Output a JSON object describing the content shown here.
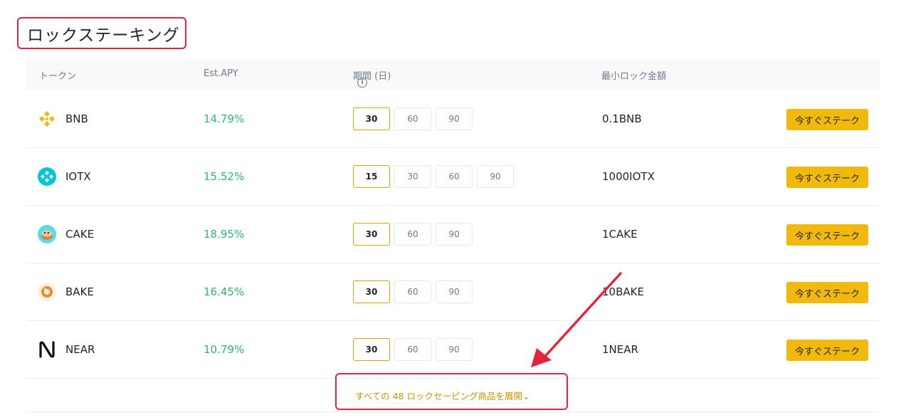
{
  "page": {
    "title": "ロックステーキング"
  },
  "table": {
    "headers": {
      "token": "トークン",
      "apy": "Est.APY",
      "period": "期間 (日)",
      "min_amount": "最小ロック金額"
    },
    "rows": [
      {
        "token": "BNB",
        "icon": "bnb-icon",
        "apy": "14.79%",
        "periods": [
          "30",
          "60",
          "90"
        ],
        "selected": "30",
        "min": "0.1BNB",
        "action": "今すぐステーク"
      },
      {
        "token": "IOTX",
        "icon": "iotx-icon",
        "apy": "15.52%",
        "periods": [
          "15",
          "30",
          "60",
          "90"
        ],
        "selected": "15",
        "min": "1000IOTX",
        "action": "今すぐステーク"
      },
      {
        "token": "CAKE",
        "icon": "cake-icon",
        "apy": "18.95%",
        "periods": [
          "30",
          "60",
          "90"
        ],
        "selected": "30",
        "min": "1CAKE",
        "action": "今すぐステーク"
      },
      {
        "token": "BAKE",
        "icon": "bake-icon",
        "apy": "16.45%",
        "periods": [
          "30",
          "60",
          "90"
        ],
        "selected": "30",
        "min": "10BAKE",
        "action": "今すぐステーク"
      },
      {
        "token": "NEAR",
        "icon": "near-icon",
        "apy": "10.79%",
        "periods": [
          "30",
          "60",
          "90"
        ],
        "selected": "30",
        "min": "1NEAR",
        "action": "今すぐステーク"
      }
    ]
  },
  "footer": {
    "expand_label": "すべての 48 ロックセーピング商品を展開"
  },
  "colors": {
    "accent": "#f0b90b",
    "apy_green": "#2eb76f",
    "annotation_red": "#e0263a"
  }
}
